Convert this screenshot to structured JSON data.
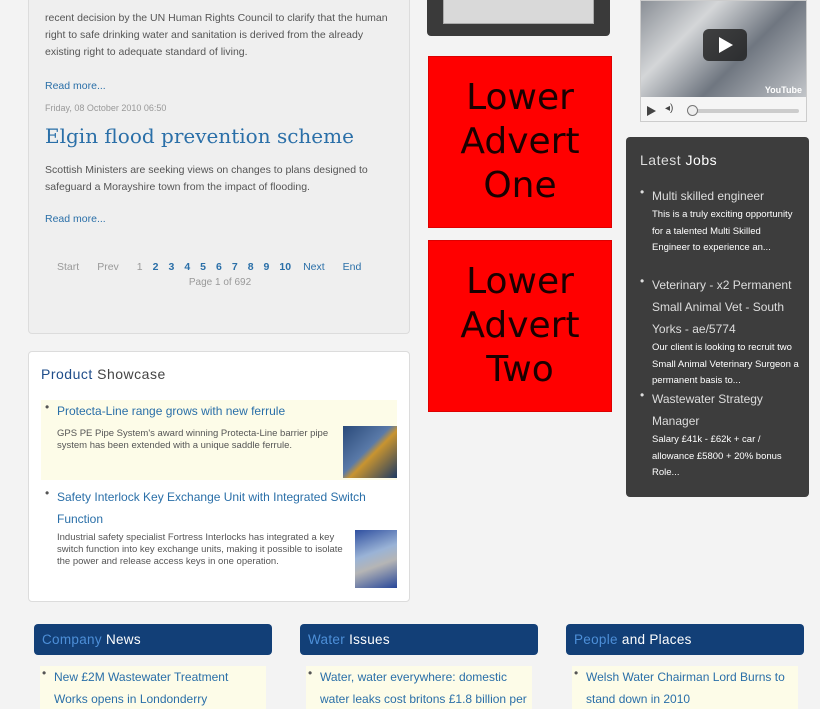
{
  "articles": {
    "intro_text": "recent decision by the UN Human Rights Council to clarify  that the human right to safe drinking water and sanitation is derived from the already existing right to adequate standard of living.",
    "read_more_1": "Read more...",
    "date": "Friday, 08 October 2010 06:50",
    "title": "Elgin flood prevention scheme",
    "body": "Scottish Ministers are seeking views on changes to plans designed to safeguard a Morayshire town from the impact of flooding.",
    "read_more_2": "Read more...",
    "pagination": {
      "start": "Start",
      "prev": "Prev",
      "pages": [
        "1",
        "2",
        "3",
        "4",
        "5",
        "6",
        "7",
        "8",
        "9",
        "10"
      ],
      "next": "Next",
      "end": "End",
      "page_info": "Page 1 of 692"
    }
  },
  "showcase": {
    "title_highlight": "Product",
    "title_rest": " Showcase",
    "items": [
      {
        "link": "Protecta-Line range grows with new ferrule",
        "desc": "GPS PE Pipe System's award winning Protecta-Line barrier pipe system has been extended with a unique saddle ferrule."
      },
      {
        "link": "Safety Interlock Key Exchange Unit with Integrated Switch Function",
        "desc": "Industrial safety specialist Fortress Interlocks has integrated a key switch function into key exchange units, making it possible to isolate the power and release access keys in one operation."
      }
    ]
  },
  "adverts": {
    "one": "Lower Advert One",
    "two": "Lower Advert Two"
  },
  "video": {
    "brand": "YouTube"
  },
  "jobs": {
    "title_rest": "Latest ",
    "title_highlight": "Jobs",
    "items": [
      {
        "title": "Multi skilled engineer",
        "desc": "This is a truly exciting opportunity for a talented Multi Skilled Engineer to experience an..."
      },
      {
        "title": "Veterinary - x2 Permanent Small Animal Vet - South Yorks - ae/5774",
        "desc": "Our client is looking to recruit two Small Animal Veterinary Surgeon a permanent basis to..."
      },
      {
        "title": "Wastewater Strategy Manager",
        "desc": "Salary £41k - £62k + car / allowance £5800 + 20% bonus Role..."
      }
    ]
  },
  "bottom": {
    "columns": [
      {
        "head_highlight": "Company",
        "head_rest": " News",
        "item": "New £2M Wastewater Treatment Works opens in Londonderry"
      },
      {
        "head_highlight": "Water",
        "head_rest": " Issues",
        "item": "Water, water everywhere: domestic water leaks cost britons £1.8 billion per"
      },
      {
        "head_highlight": "People",
        "head_rest": " and Places",
        "item": "Welsh Water Chairman Lord Burns to stand down in 2010"
      }
    ]
  },
  "colors": {
    "link": "#2a6fa8",
    "advert_red": "#ff0000",
    "nav_blue": "#123f77",
    "jobs_bg": "#3d3d3d"
  }
}
